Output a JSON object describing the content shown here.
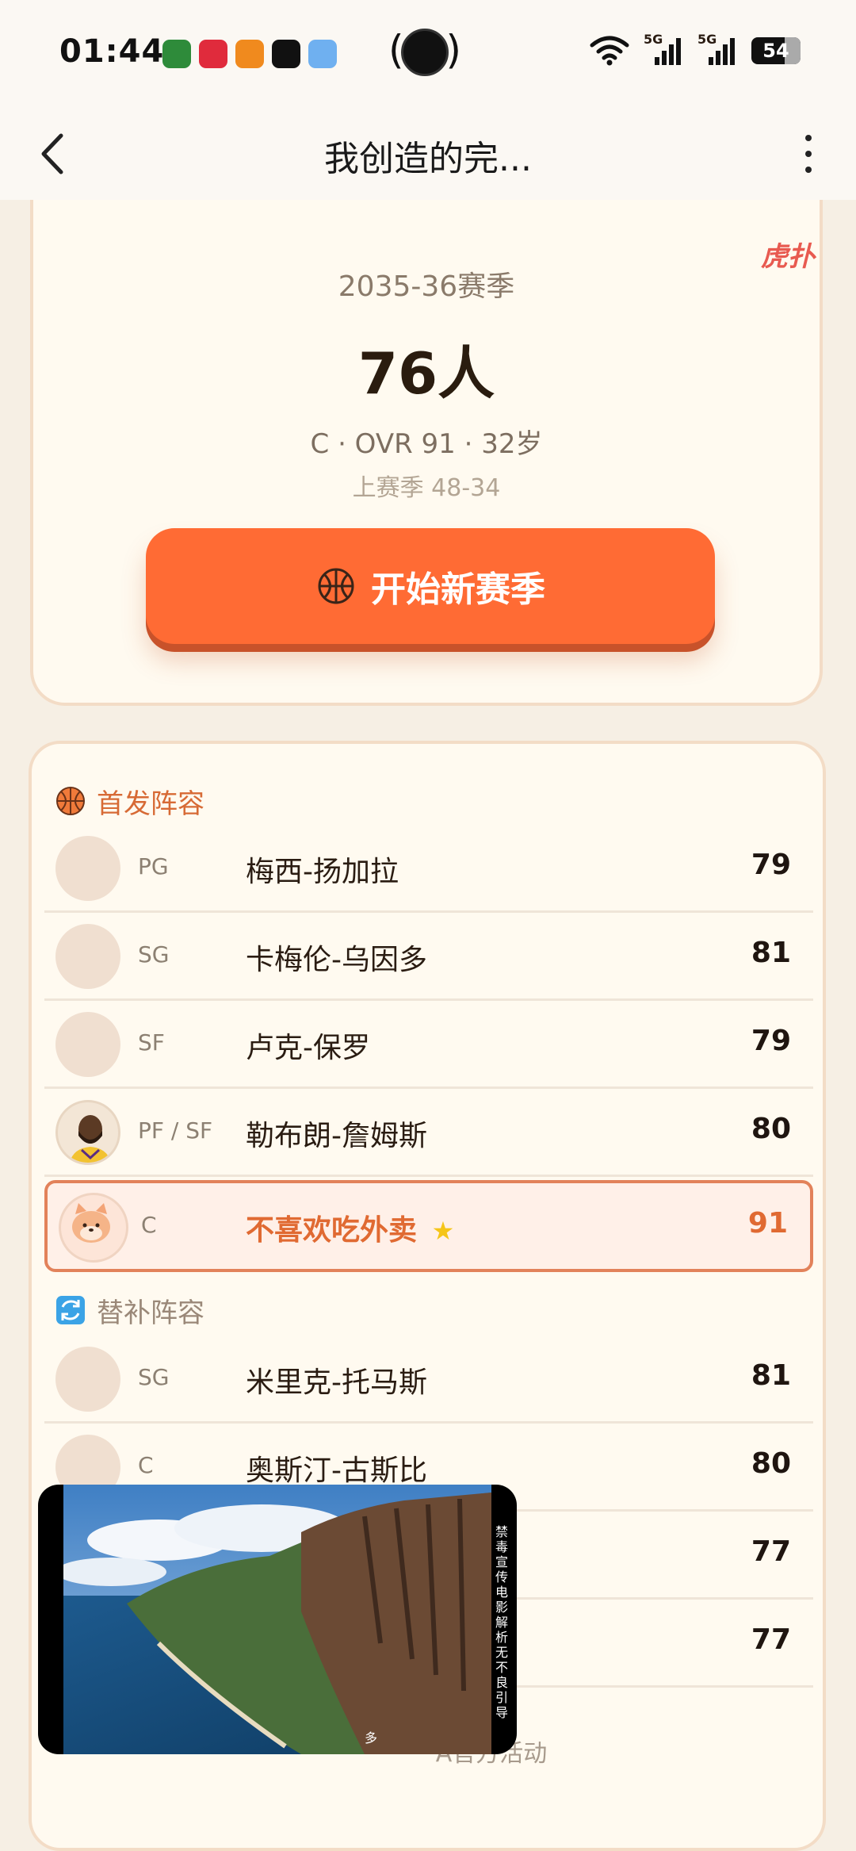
{
  "status_bar": {
    "time": "01:44",
    "battery": "54",
    "signal_1": "5G",
    "signal_2": "5G"
  },
  "nav": {
    "title": "我创造的完..."
  },
  "season_card": {
    "season": "2035-36赛季",
    "team": "76人",
    "meta": "C · OVR 91 · 32岁",
    "last_season": "上赛季 48-34",
    "watermark": "虎扑",
    "start_button": "开始新赛季"
  },
  "roster": {
    "starters_label": "首发阵容",
    "bench_label": "替补阵容",
    "starters": [
      {
        "pos": "PG",
        "name": "梅西-扬加拉",
        "ovr": "79"
      },
      {
        "pos": "SG",
        "name": "卡梅伦-乌因多",
        "ovr": "81"
      },
      {
        "pos": "SF",
        "name": "卢克-保罗",
        "ovr": "79"
      },
      {
        "pos": "PF / SF",
        "name": "勒布朗-詹姆斯",
        "ovr": "80"
      },
      {
        "pos": "C",
        "name": "不喜欢吃外卖",
        "ovr": "91"
      }
    ],
    "bench": [
      {
        "pos": "SG",
        "name": "米里克-托马斯",
        "ovr": "81"
      },
      {
        "pos": "C",
        "name": "奥斯汀-古斯比",
        "ovr": "80"
      },
      {
        "pos": "",
        "name": "",
        "ovr": "77"
      },
      {
        "pos": "",
        "name": "",
        "ovr": "77"
      }
    ]
  },
  "bottom_text": "A官方活动",
  "pip_video": {
    "side_text": "禁毒宣传 电影解析 无不良引导",
    "corner_text": "多"
  },
  "colors": {
    "accent": "#ff6b34",
    "background": "#f6efe4",
    "card": "#fffaf0"
  }
}
